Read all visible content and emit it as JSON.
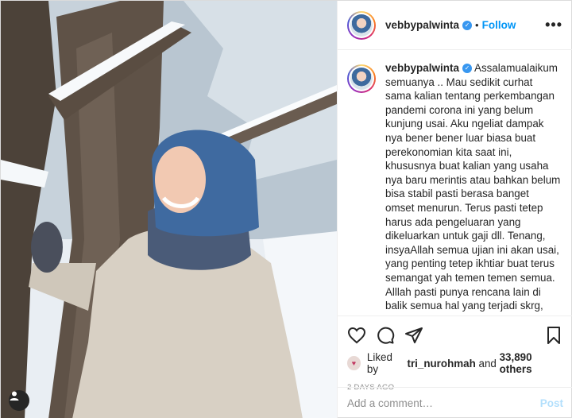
{
  "header": {
    "username": "vebbypalwinta",
    "separator": "•",
    "follow_label": "Follow",
    "more_label": "•••"
  },
  "caption": {
    "username": "vebbypalwinta",
    "text": "Assalamualaikum semuanya .. Mau sedikit curhat sama kalian tentang perkembangan pandemi corona ini yang belum kunjung usai. Aku ngeliat dampak nya bener bener luar biasa buat perekonomian kita saat ini, khususnya buat kalian yang usaha nya baru merintis atau bahkan belum bisa stabil pasti berasa banget omset menurun. Terus pasti tetep harus ada pengeluaran yang dikeluarkan untuk gaji dll. Tenang, insyaAllah semua ujian ini akan usai, yang penting tetep ikhtiar buat terus semangat yah temen temen semua. Alllah pasti punya rencana lain di balik semua hal yang terjadi skrg, insyaAllah temen temen"
  },
  "likes": {
    "prefix": "Liked by ",
    "liker": "tri_nurohmah",
    "middle": " and ",
    "count": "33,890 others"
  },
  "timestamp": "2 DAYS AGO",
  "comment_box": {
    "placeholder": "Add a comment…",
    "post_label": "Post"
  },
  "icons": {
    "like": "heart-icon",
    "comment": "comment-icon",
    "share": "paper-plane-icon",
    "save": "bookmark-icon",
    "tag": "user-tag-icon",
    "verified": "verified-badge-icon"
  },
  "colors": {
    "accent": "#0095f6",
    "verified": "#3897f0",
    "muted": "#8e8e8e"
  }
}
